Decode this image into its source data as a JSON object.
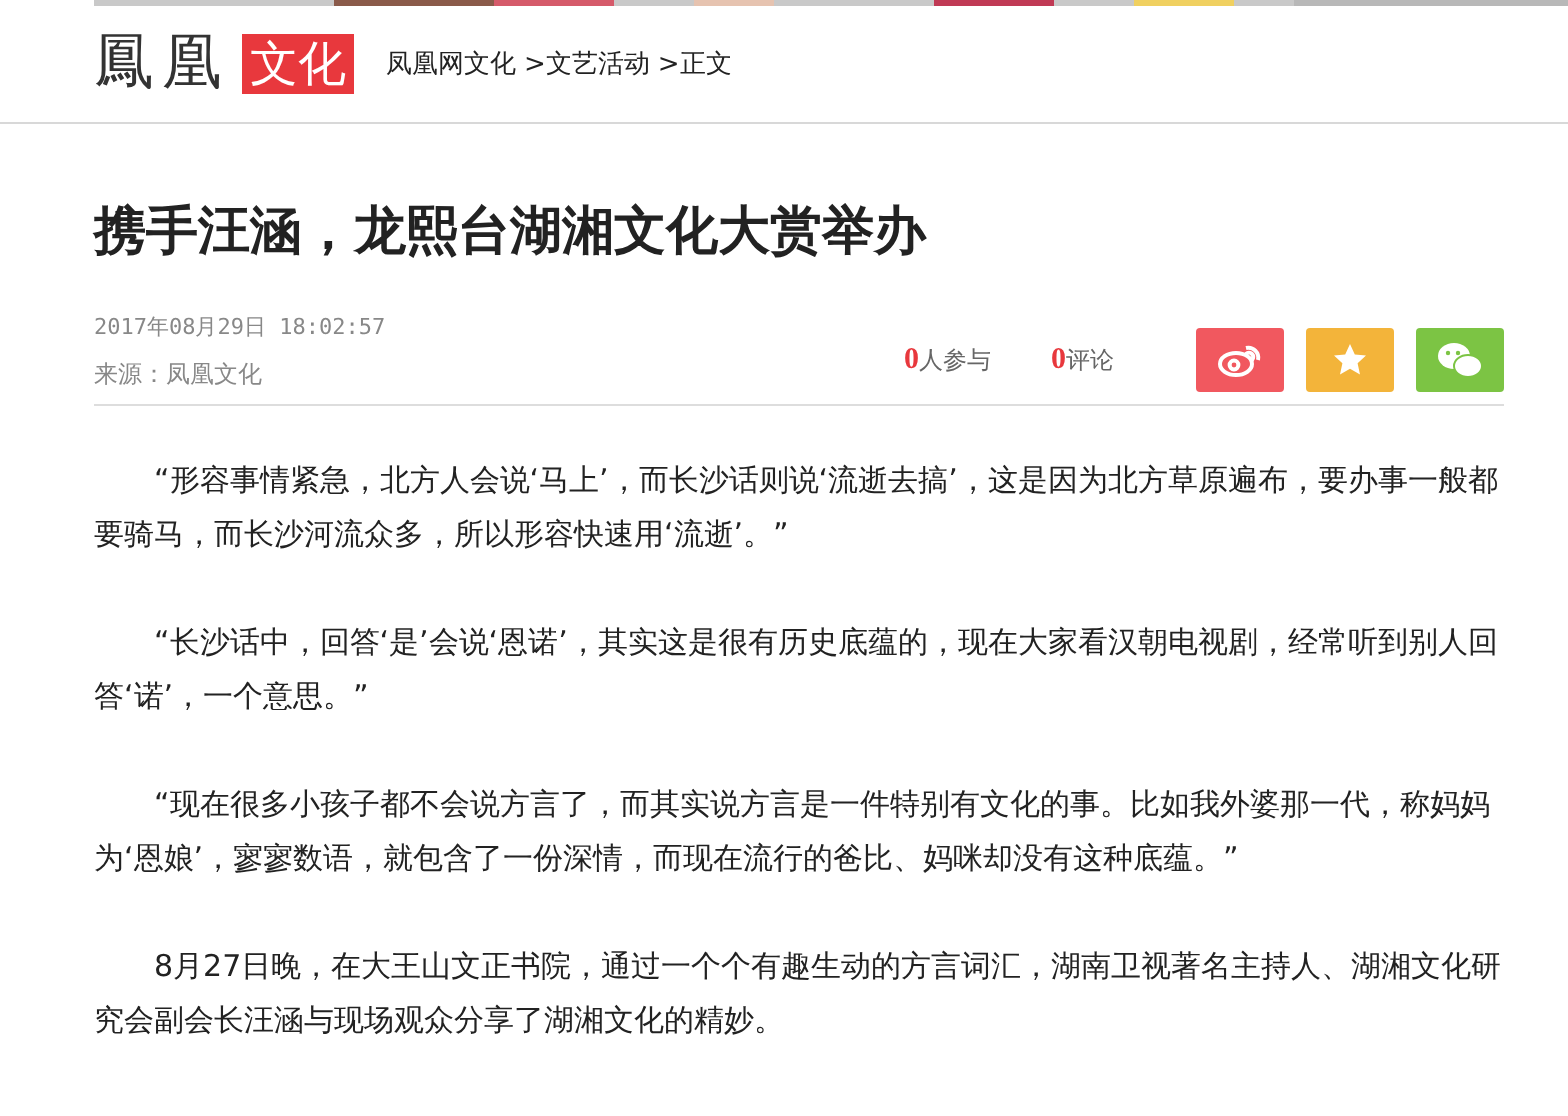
{
  "header": {
    "logo_main": "鳳凰",
    "logo_tag": "文化",
    "breadcrumb": [
      "凤凰网文化",
      ">文艺活动",
      ">正文"
    ]
  },
  "article": {
    "title": "携手汪涵，龙熙台湖湘文化大赏举办",
    "date": "2017年08月29日 18:02:57",
    "source": "来源：凤凰文化",
    "stats": [
      {
        "count": "0",
        "label": "人参与"
      },
      {
        "count": "0",
        "label": "评论"
      }
    ],
    "share": [
      {
        "kind": "weibo",
        "color": "#f1585f"
      },
      {
        "kind": "favorite",
        "color": "#f3b43a"
      },
      {
        "kind": "wechat",
        "color": "#7cc444"
      }
    ],
    "paragraphs": [
      "“形容事情紧急，北方人会说‘马上’，而长沙话则说‘流逝去搞’，这是因为北方草原遍布，要办事一般都要骑马，而长沙河流众多，所以形容快速用‘流逝’。”",
      "“长沙话中，回答‘是’会说‘恩诺’，其实这是很有历史底蕴的，现在大家看汉朝电视剧，经常听到别人回答‘诺’，一个意思。”",
      "“现在很多小孩子都不会说方言了，而其实说方言是一件特别有文化的事。比如我外婆那一代，称妈妈为‘恩娘’，寥寥数语，就包含了一份深情，而现在流行的爸比、妈咪却没有这种底蕴。”",
      "8月27日晚，在大王山文正书院，通过一个个有趣生动的方言词汇，湖南卫视著名主持人、湖湘文化研究会副会长汪涵与现场观众分享了湖湘文化的精妙。"
    ]
  }
}
